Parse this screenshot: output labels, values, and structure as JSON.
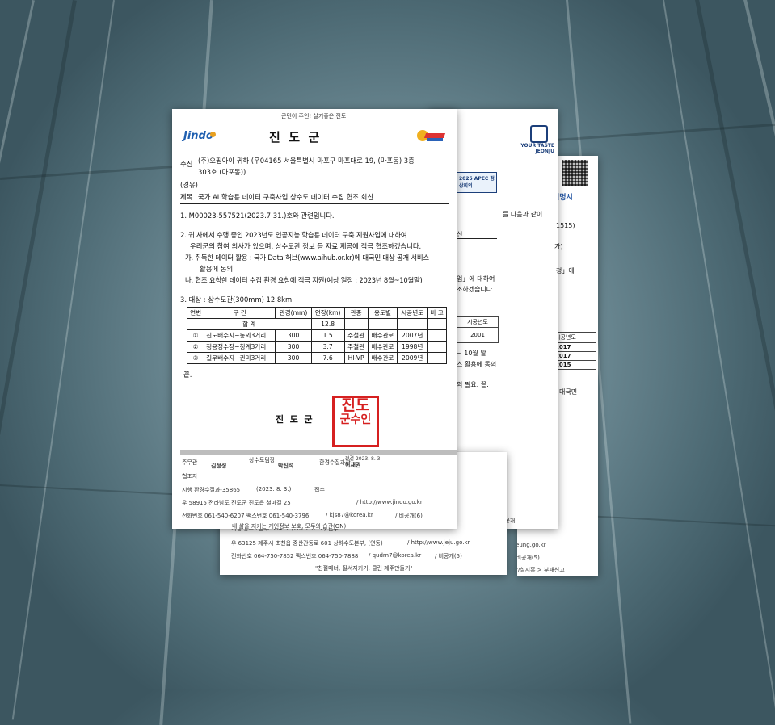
{
  "main_letter": {
    "motto": "군민이 주인! 살기좋은 진도",
    "org_logo_text": "Jindo",
    "org_title": "진  도  군",
    "recipient_label": "수신",
    "recipient_line1": "(주)오핌아이 귀하 (우04165 서울특별시 마포구 마포대로 19, (마포동) 3층",
    "recipient_line2": "303호 (마포동))",
    "via": "(경유)",
    "subject_label": "제목",
    "subject": "국가 AI 학습용 데이터 구축사업 상수도 데이터 수집 협조 회신",
    "body": {
      "p1": "1. M00023-557521(2023.7.31.)호와 관련입니다.",
      "p2a": "2. 귀 사에서 수행 중인 2023년도 인공지능 학습용 데이터 구축 지원사업에 대하여",
      "p2b": "우리군의 참여 의사가 있으며, 상수도관 정보 등 자료 제공에 적극 협조하겠습니다.",
      "ga1": "가. 취득한 데이터 활용 : 국가 Data 허브(www.aihub.or.kr)에 대국민 대상 공개 서비스",
      "ga2": "활용에 동의",
      "na": "나. 협조 요청한 데이터 수집 환경 요청에 적극 지원(예상 일정 : 2023년 8월~10월말)",
      "p3": "3. 대상 : 상수도관(300mm) 12.8km",
      "end": "끝."
    },
    "table": {
      "headers": [
        "연번",
        "구 간",
        "관경(mm)",
        "연장(km)",
        "관종",
        "용도별",
        "시공년도",
        "비 고"
      ],
      "total_label": "합  계",
      "total_length": "12.8",
      "rows": [
        [
          "①",
          "진도배수지~동외3거리",
          "300",
          "1.5",
          "주철관",
          "배수관로",
          "2007년",
          ""
        ],
        [
          "②",
          "청용정수장~칭계3거리",
          "300",
          "3.7",
          "주철관",
          "배수관로",
          "1998년",
          ""
        ],
        [
          "③",
          "길우배수지~권미3거리",
          "300",
          "7.6",
          "HI-VP",
          "배수관로",
          "2009년",
          ""
        ]
      ]
    },
    "signature_title": "진  도  군",
    "seal_text": [
      "진도",
      "군수인"
    ],
    "footer": {
      "r1a": "주무관",
      "r1a_name": "김정성",
      "r1b": "상수도팀장",
      "r1b_name": "박진석",
      "r1c": "환경수질과장",
      "r1c_date": "전결 2023. 8. 3.",
      "r1c_name": "이재권",
      "r2": "협조자",
      "r3a": "시행  환경수질과-35865",
      "r3b": "(2023. 8. 3.)",
      "r3c": "접수",
      "r4a": "우  58915   전라남도 진도군 진도읍 철마길 25",
      "r4b": "/  http://www.jindo.go.kr",
      "r5a": "전화번호  061-540-6207   팩스번호  061-540-3796",
      "r5b": "/  kjs87@korea.kr",
      "r5c": "/ 비공개(6)",
      "r6": "내 삶을 지키는 개인정보 보호, 모두의 습관(ON)!"
    }
  },
  "jeju_letter": {
    "r1": "시행  상수도본부-38472   (2023. 8. 3.)   접수",
    "r2a": "우  63125     제주시 초천읍 중산간동로 601 상하수도본부, (연동)",
    "r2b": "/  http://www.jeju.go.kr",
    "r3a": "전화번호  064-750-7852      팩스번호  064-750-7888",
    "r3b": "/  qudrn7@korea.kr",
    "r3c": "/ 비공개(5)",
    "slogan": "\"친절매너, 질서지키기, 클린 제주만들기\""
  },
  "jeonju_letter": {
    "logo_text": "YOUR TASTE JEONJU",
    "apec_badge": "2025 APEC 정상회의",
    "frag1": "를 다음과 같이",
    "frag2": "1515)",
    "frag3": "가)",
    "frag4": "신",
    "frag5": "청」에",
    "frag6": "업」에 대하여",
    "frag7": "조하겠습니다.",
    "year_header": "시공년도",
    "year_value": "2001",
    "frag8": "~ 10월 말",
    "frag9": "스 활용에 동의",
    "frag10": "의 필요. 끝.",
    "foot1": "진공개"
  },
  "siheung_letter": {
    "header_frag": "현명시",
    "years_header": "시공년도",
    "years": [
      "2017",
      "2017",
      "2015"
    ],
    "frag_right": "대국민",
    "foot_url": "siheung.go.kr",
    "foot_priv": "/ 비공개(5)",
    "foot_slogan": "경환/실시흥 > 부패신고"
  }
}
